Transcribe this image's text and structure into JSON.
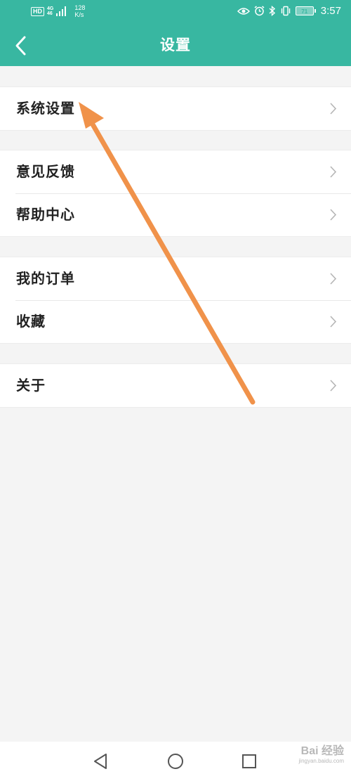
{
  "status_bar": {
    "hd_label": "HD",
    "net_top": "4G",
    "net_bottom": "46",
    "speed_value": "128",
    "speed_unit": "K/s",
    "battery_level": "71",
    "time": "3:57"
  },
  "header": {
    "title": "设置"
  },
  "groups": [
    {
      "items": [
        {
          "label": "系统设置"
        }
      ]
    },
    {
      "items": [
        {
          "label": "意见反馈"
        },
        {
          "label": "帮助中心"
        }
      ]
    },
    {
      "items": [
        {
          "label": "我的订单"
        },
        {
          "label": "收藏"
        }
      ]
    },
    {
      "items": [
        {
          "label": "关于"
        }
      ]
    }
  ],
  "watermark": {
    "text": "Bai 经验",
    "subtext": "jingyan.baidu.com"
  },
  "colors": {
    "accent": "#38b7a1",
    "annotation_arrow": "#f0924a",
    "background": "#f4f4f4"
  },
  "icons": {
    "back": "chevron-left-icon",
    "row": "chevron-right-icon",
    "nav_back": "triangle-back-icon",
    "nav_home": "circle-home-icon",
    "nav_recent": "square-recent-icon"
  }
}
